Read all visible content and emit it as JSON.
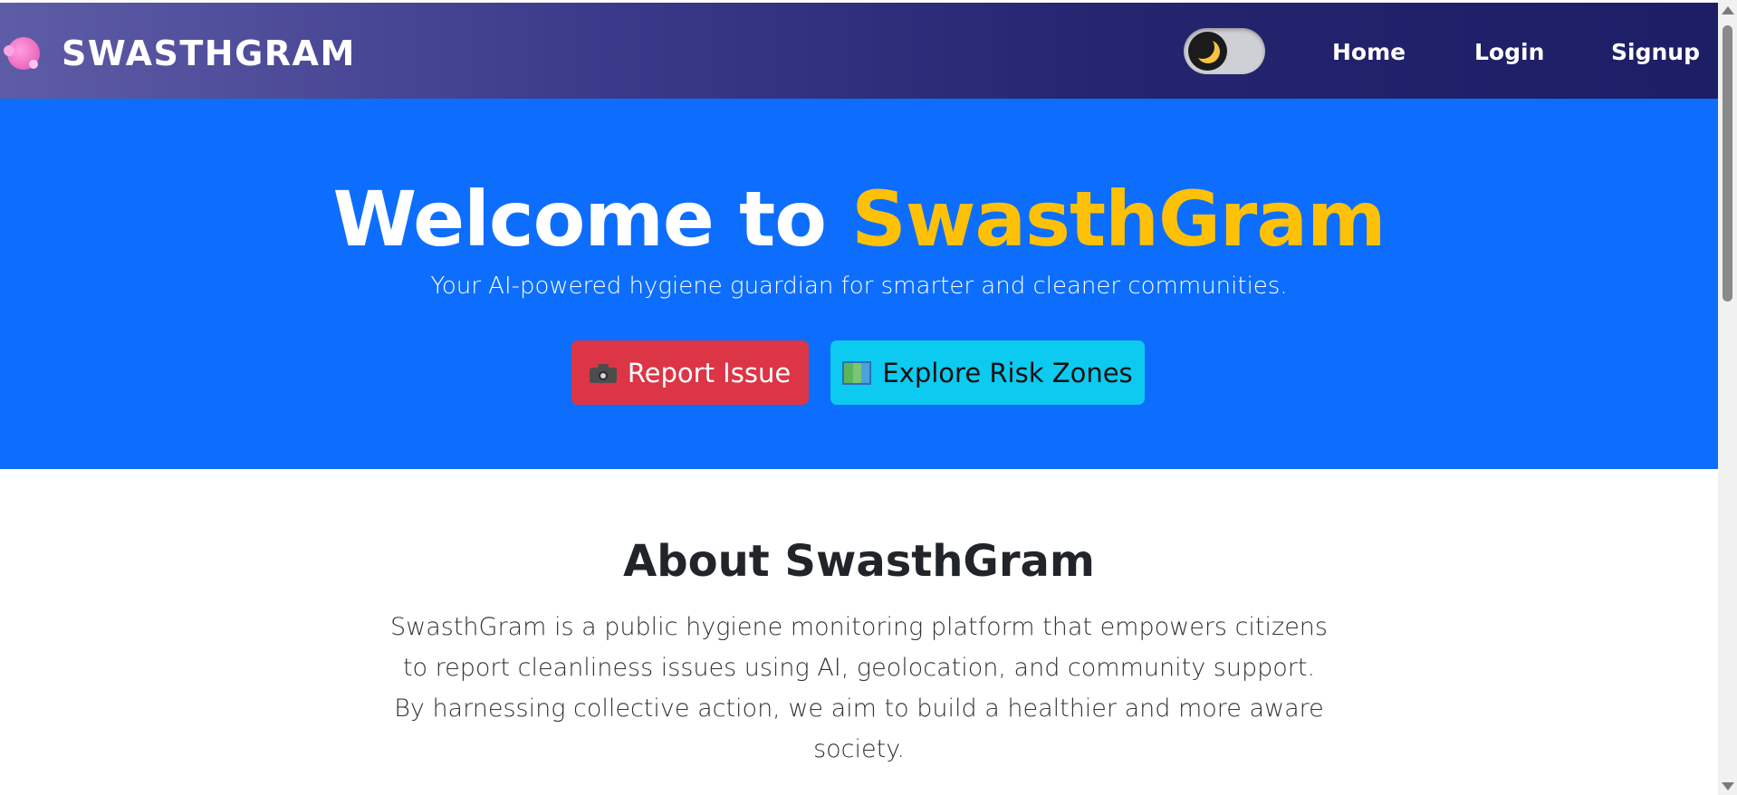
{
  "navbar": {
    "brand": "SWASTHGRAM",
    "theme_toggle_icon": "moon-icon",
    "links": [
      "Home",
      "Login",
      "Signup"
    ]
  },
  "hero": {
    "title_prefix": "Welcome to ",
    "title_accent": "SwasthGram",
    "subtitle": "Your AI-powered hygiene guardian for smarter and cleaner communities.",
    "buttons": {
      "report": {
        "label": "Report Issue",
        "icon": "camera-icon"
      },
      "explore": {
        "label": "Explore Risk Zones",
        "icon": "map-icon"
      }
    }
  },
  "about": {
    "title": "About SwasthGram",
    "text": "SwasthGram is a public hygiene monitoring platform that empowers citizens to report cleanliness issues using AI, geolocation, and community support. By harnessing collective action, we aim to build a healthier and more aware society."
  },
  "colors": {
    "hero_bg": "#0d6efd",
    "accent": "#ffc107",
    "report_button": "#dc3545",
    "explore_button": "#0dcaf0",
    "navbar_start": "#5e5ca6",
    "navbar_end": "#1d1e66"
  }
}
